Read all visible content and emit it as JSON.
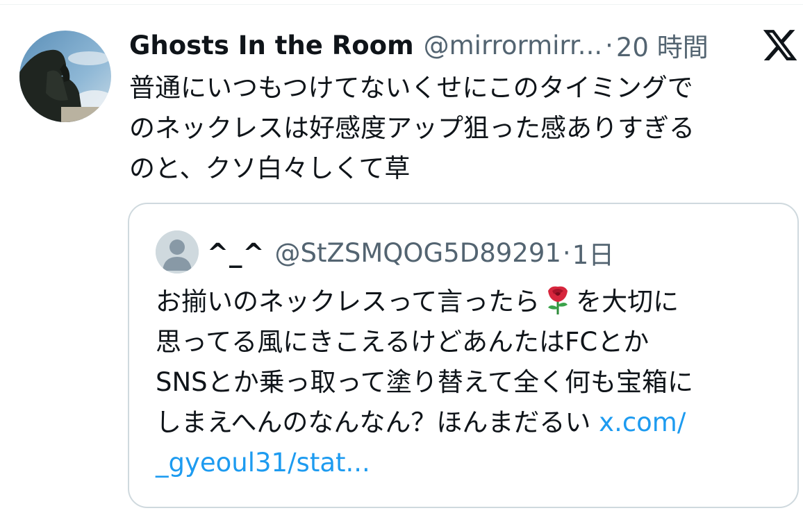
{
  "tweet": {
    "author": {
      "display_name": "Ghosts In the Room",
      "handle": "@mirrormirr...",
      "avatar_icon": "thinker-statue-avatar"
    },
    "separator": "·",
    "time": "20 時間",
    "platform_icon": "x-logo-icon",
    "text_lines": [
      "普通にいつもつけてないくせにこのタイミングで",
      "のネックレスは好感度アップ狙った感ありすぎる",
      "のと、クソ白々しくて草"
    ]
  },
  "quote": {
    "author": {
      "display_name": "^_^",
      "handle": "@StZSMQOG5D89291",
      "avatar_icon": "default-user-avatar"
    },
    "separator": "·",
    "time": "1日",
    "line1_before": "お揃いのネックレスって言ったら",
    "emoji": "rose-emoji",
    "line1_after": "を大切に",
    "lines": [
      "思ってる風にきこえるけどあんたはFCとか",
      "SNSとか乗っ取って塗り替えて全く何も宝箱に"
    ],
    "line4_text": "しまえへんのなんなん？ほんまだるい ",
    "link_part1": "x.com/",
    "link_part2": "_gyeoul31/stat..."
  },
  "colors": {
    "text": "#0f1419",
    "secondary": "#536471",
    "link": "#1d9bf0",
    "border": "#cfd9de"
  }
}
